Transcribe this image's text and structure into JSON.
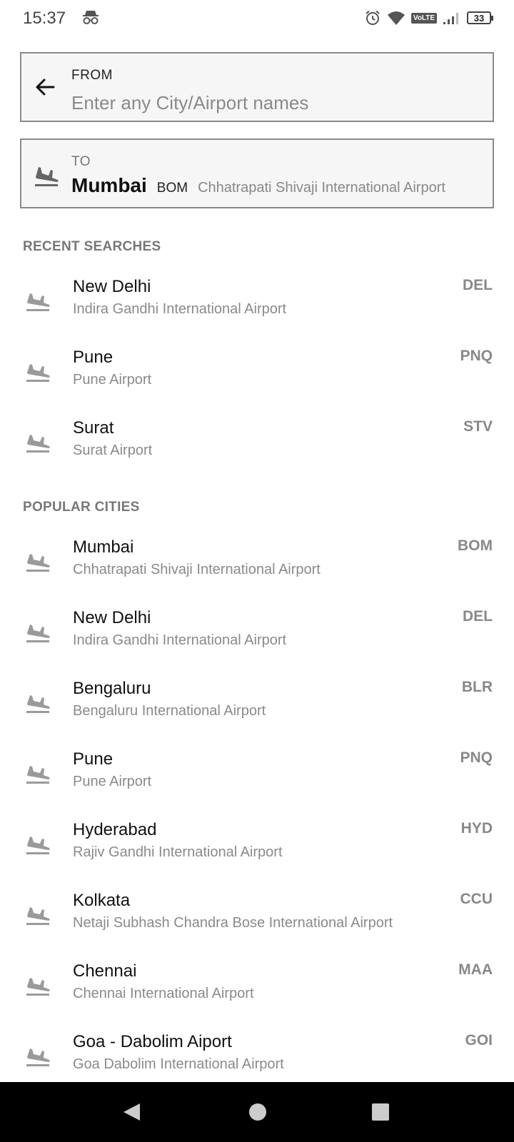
{
  "status_bar": {
    "time": "15:37",
    "volte": "VoLTE",
    "battery": "33",
    "icons": [
      "incognito-icon",
      "alarm-icon",
      "wifi-icon",
      "volte-icon",
      "signal-icon",
      "battery-icon"
    ]
  },
  "from_field": {
    "label": "FROM",
    "placeholder": "Enter any City/Airport names",
    "value": ""
  },
  "to_field": {
    "label": "TO",
    "city": "Mumbai",
    "code": "BOM",
    "airport": "Chhatrapati Shivaji International Airport"
  },
  "recent": {
    "title": "RECENT SEARCHES",
    "items": [
      {
        "city": "New Delhi",
        "airport": "Indira Gandhi International Airport",
        "code": "DEL"
      },
      {
        "city": "Pune",
        "airport": "Pune Airport",
        "code": "PNQ"
      },
      {
        "city": "Surat",
        "airport": "Surat Airport",
        "code": "STV"
      }
    ]
  },
  "popular": {
    "title": "POPULAR CITIES",
    "items": [
      {
        "city": "Mumbai",
        "airport": "Chhatrapati Shivaji International Airport",
        "code": "BOM"
      },
      {
        "city": "New Delhi",
        "airport": "Indira Gandhi International Airport",
        "code": "DEL"
      },
      {
        "city": "Bengaluru",
        "airport": "Bengaluru International Airport",
        "code": "BLR"
      },
      {
        "city": "Pune",
        "airport": "Pune Airport",
        "code": "PNQ"
      },
      {
        "city": "Hyderabad",
        "airport": "Rajiv Gandhi International Airport",
        "code": "HYD"
      },
      {
        "city": "Kolkata",
        "airport": "Netaji Subhash Chandra Bose International Airport",
        "code": "CCU"
      },
      {
        "city": "Chennai",
        "airport": "Chennai International Airport",
        "code": "MAA"
      },
      {
        "city": "Goa - Dabolim Aiport",
        "airport": "Goa Dabolim International Airport",
        "code": "GOI"
      }
    ]
  },
  "nav": [
    "back-icon",
    "home-icon",
    "recents-icon"
  ]
}
